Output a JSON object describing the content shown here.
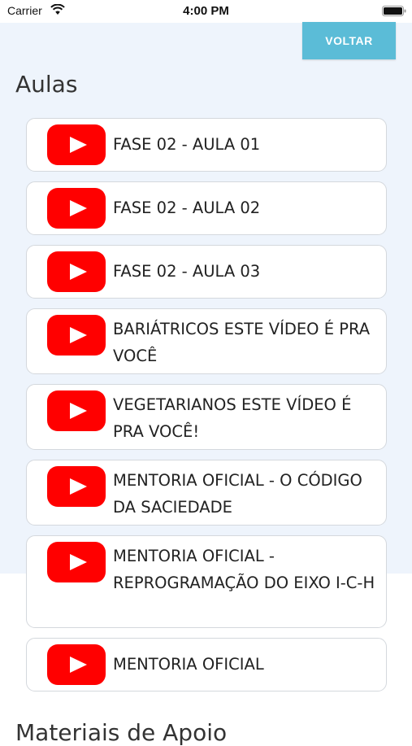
{
  "status_bar": {
    "carrier": "Carrier",
    "time": "4:00 PM",
    "icons": [
      "wifi-icon",
      "battery-icon"
    ]
  },
  "header": {
    "back_label": "VOLTAR",
    "title": "Aulas"
  },
  "lessons": [
    {
      "label": "FASE 02 - AULA 01",
      "icon": "youtube-play-icon"
    },
    {
      "label": "FASE 02 - AULA 02",
      "icon": "youtube-play-icon"
    },
    {
      "label": "FASE 02 - AULA 03",
      "icon": "youtube-play-icon"
    },
    {
      "label": "BARIÁTRICOS ESTE VÍDEO É PRA VOCÊ",
      "icon": "youtube-play-icon"
    },
    {
      "label": "VEGETARIANOS ESTE VÍDEO É PRA VOCÊ!",
      "icon": "youtube-play-icon"
    },
    {
      "label": "MENTORIA OFICIAL - O CÓDIGO DA SACIEDADE",
      "icon": "youtube-play-icon"
    },
    {
      "label": "MENTORIA OFICIAL - REPROGRAMAÇÃO DO EIXO I-C-H",
      "icon": "youtube-play-icon"
    },
    {
      "label": "MENTORIA OFICIAL",
      "icon": "youtube-play-icon"
    }
  ],
  "next_section": {
    "title": "Materiais de Apoio"
  },
  "colors": {
    "accent": "#5bbcd7",
    "youtube_red": "#ff0000",
    "panel_background": "#eef4fc"
  }
}
